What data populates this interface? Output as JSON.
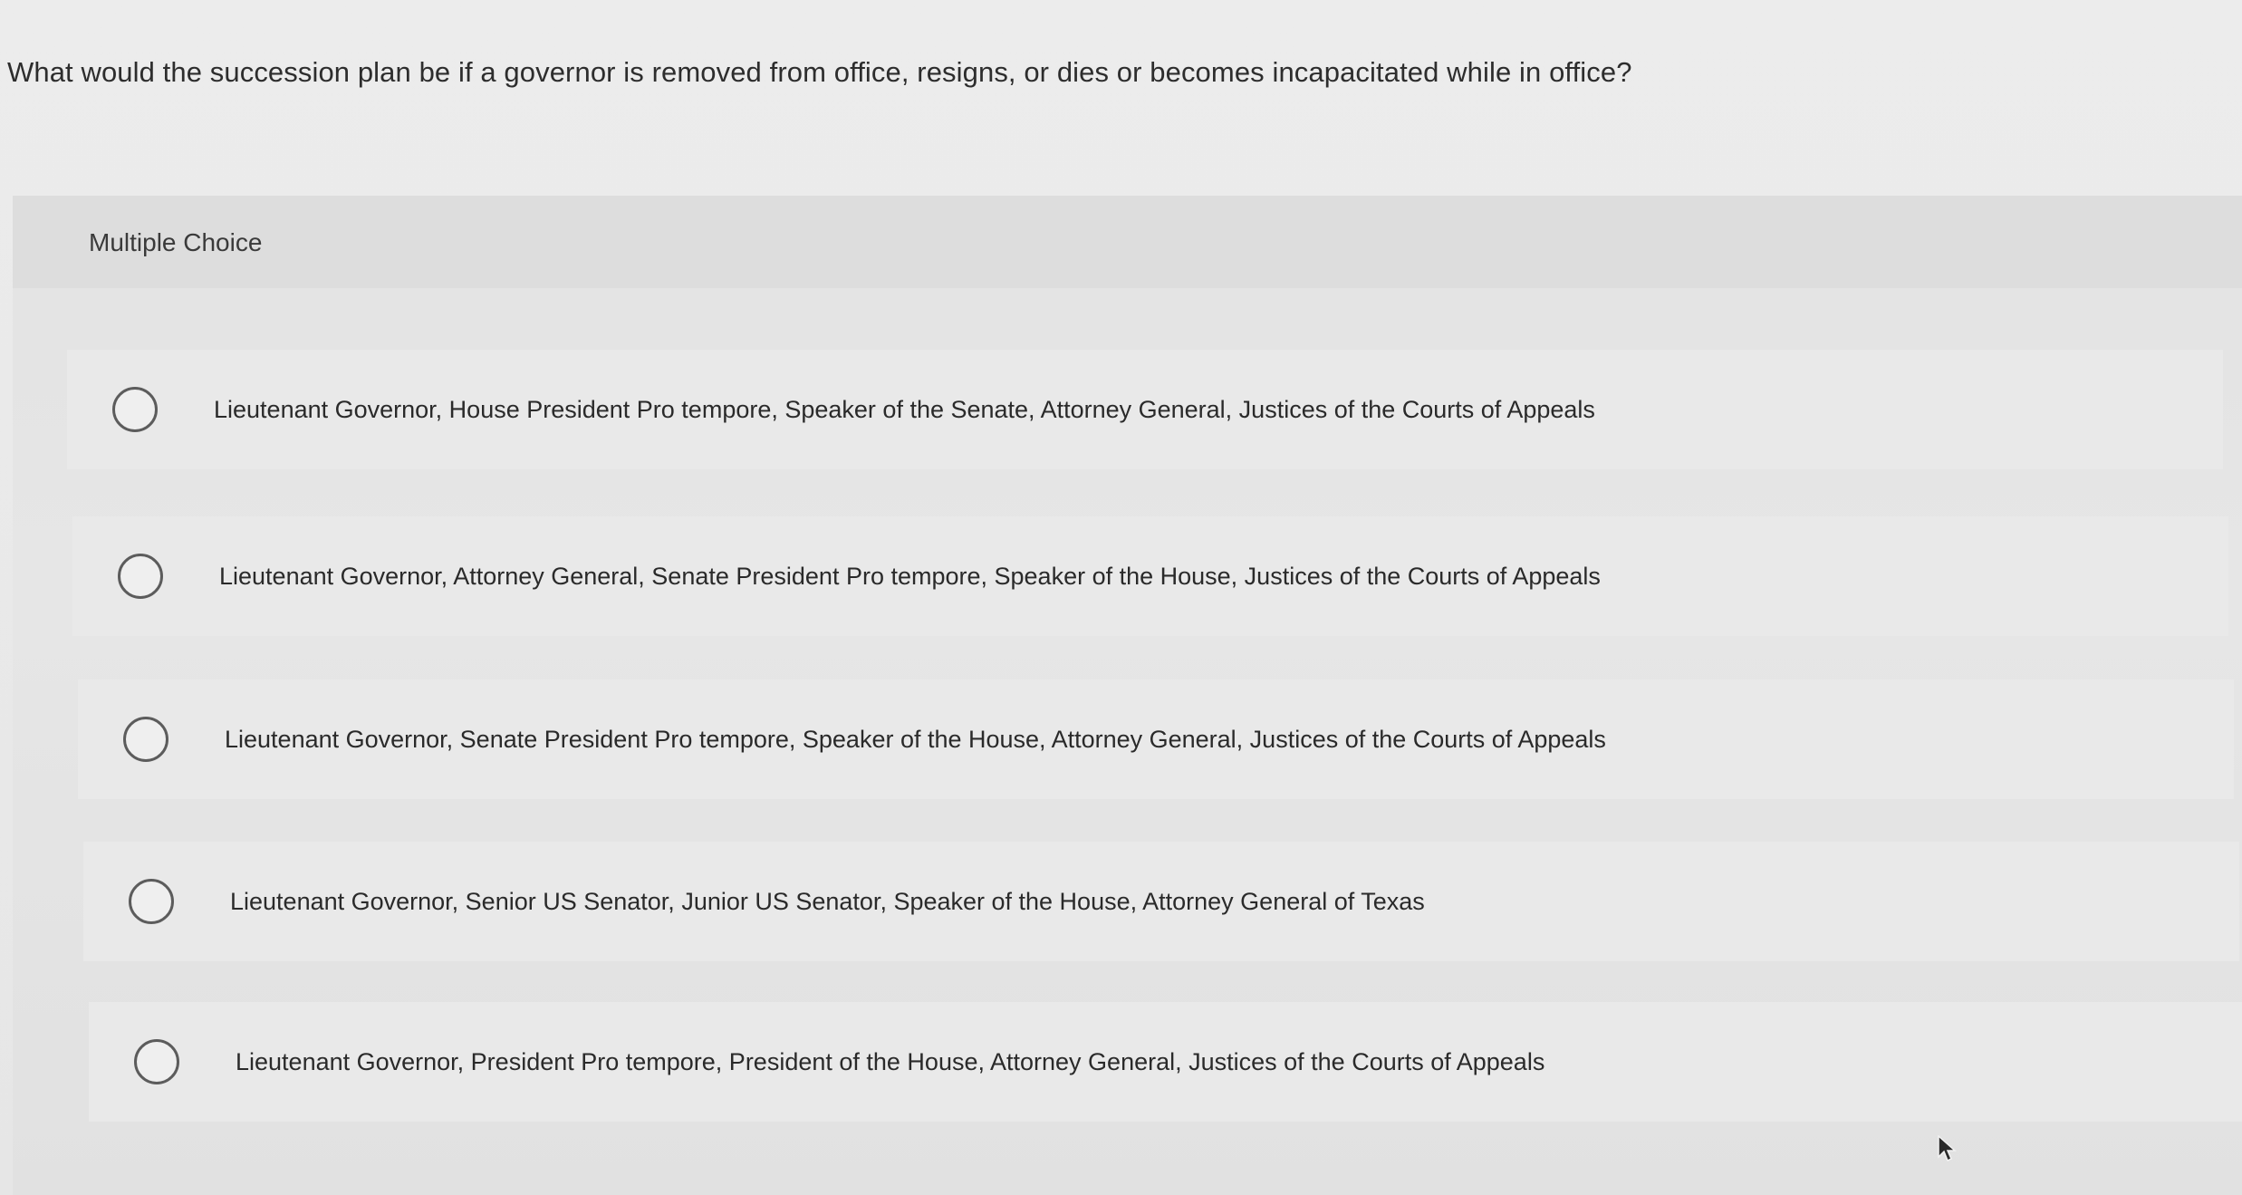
{
  "question": {
    "text": "What would the succession plan be if a governor is removed from office, resigns, or dies or becomes incapacitated while in office?"
  },
  "quiz": {
    "type_label": "Multiple Choice",
    "options": [
      {
        "label": "Lieutenant Governor, House President Pro tempore, Speaker of the Senate, Attorney General, Justices of the Courts of Appeals",
        "selected": false
      },
      {
        "label": "Lieutenant Governor, Attorney General, Senate President Pro tempore, Speaker of the House, Justices of the Courts of Appeals",
        "selected": false
      },
      {
        "label": "Lieutenant Governor, Senate President Pro tempore, Speaker of the House, Attorney General, Justices of the Courts of Appeals",
        "selected": false
      },
      {
        "label": "Lieutenant Governor, Senior US Senator, Junior US Senator, Speaker of the House, Attorney General of Texas",
        "selected": false
      },
      {
        "label": "Lieutenant Governor, President Pro tempore, President of the House, Attorney General, Justices of the Courts of Appeals",
        "selected": false
      }
    ]
  },
  "icons": {
    "radio": "radio-unchecked-icon",
    "cursor": "mouse-pointer-icon"
  },
  "colors": {
    "background": "#e9e9e9",
    "header_band": "#dddddd",
    "text": "#2b2b2b",
    "radio_border": "#5c5c5c"
  }
}
